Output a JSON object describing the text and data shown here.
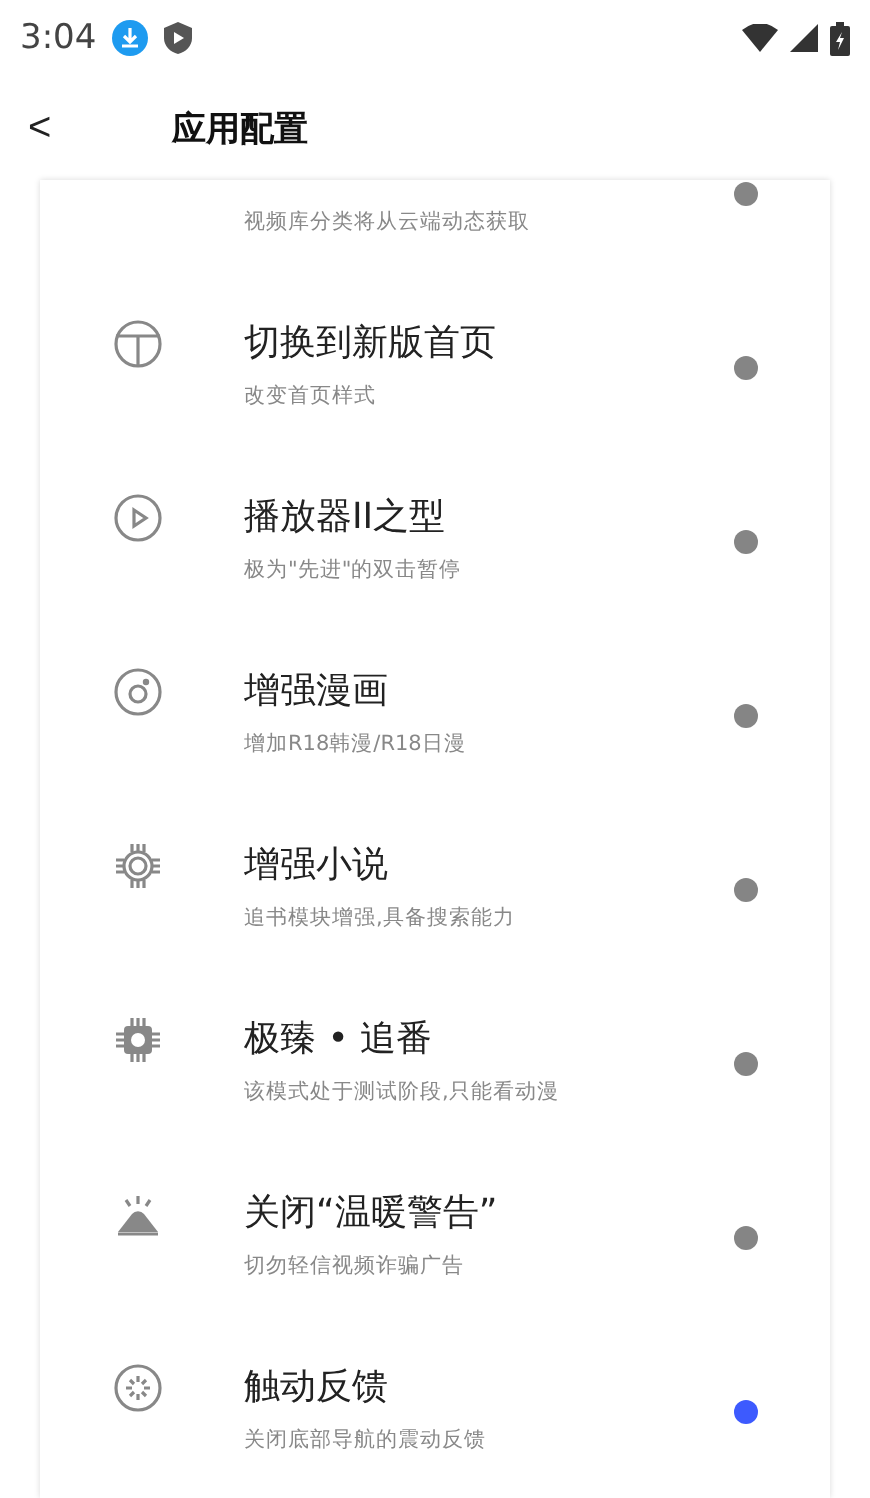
{
  "status_bar": {
    "time": "3:04"
  },
  "header": {
    "back": "<",
    "title": "应用配置"
  },
  "settings": [
    {
      "subtitle": "视频库分类将从云端动态获取",
      "on": false
    },
    {
      "title": "切换到新版首页",
      "subtitle": "改变首页样式",
      "on": false
    },
    {
      "title": "播放器II之型",
      "subtitle": "极为\"先进\"的双击暂停",
      "on": false
    },
    {
      "title": "增强漫画",
      "subtitle": "增加R18韩漫/R18日漫",
      "on": false
    },
    {
      "title": "增强小说",
      "subtitle": "追书模块增强,具备搜索能力",
      "on": false
    },
    {
      "title": "极臻 • 追番",
      "subtitle": "该模式处于测试阶段,只能看动漫",
      "on": false
    },
    {
      "title": "关闭“温暖警告”",
      "subtitle": "切勿轻信视频诈骗广告",
      "on": false
    },
    {
      "title": "触动反馈",
      "subtitle": "关闭底部导航的震动反馈",
      "on": true
    }
  ]
}
